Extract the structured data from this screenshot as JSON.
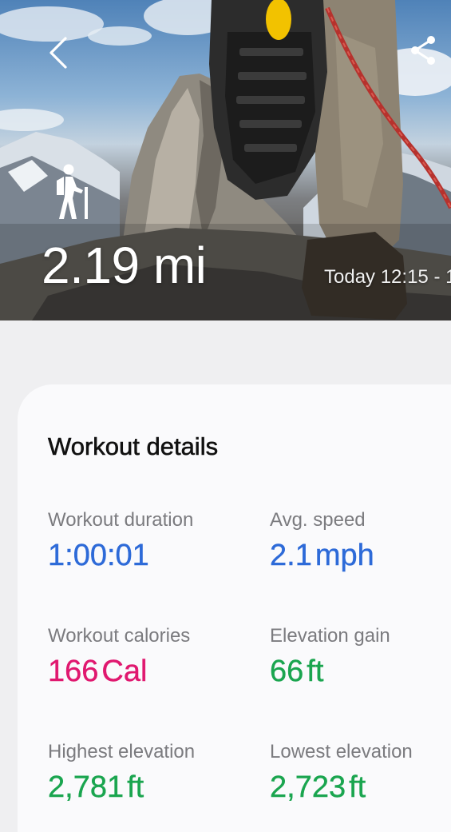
{
  "header": {
    "distance": "2.19 mi",
    "date_time": "Today 12:15 - 1",
    "back_icon": "chevron-left-icon",
    "share_icon": "share-icon",
    "activity_icon": "hiking-icon"
  },
  "details": {
    "title": "Workout details",
    "stats": [
      {
        "label": "Workout duration",
        "value": "1:00:01",
        "unit": "",
        "color": "#2d6ad8"
      },
      {
        "label": "Avg. speed",
        "value": "2.1",
        "unit": "mph",
        "color": "#2d6ad8"
      },
      {
        "label": "Workout calories",
        "value": "166",
        "unit": "Cal",
        "color": "#e0186f"
      },
      {
        "label": "Elevation gain",
        "value": "66",
        "unit": "ft",
        "color": "#1aa54f"
      },
      {
        "label": "Highest elevation",
        "value": "2,781",
        "unit": "ft",
        "color": "#1aa54f"
      },
      {
        "label": "Lowest elevation",
        "value": "2,723",
        "unit": "ft",
        "color": "#1aa54f"
      }
    ]
  }
}
